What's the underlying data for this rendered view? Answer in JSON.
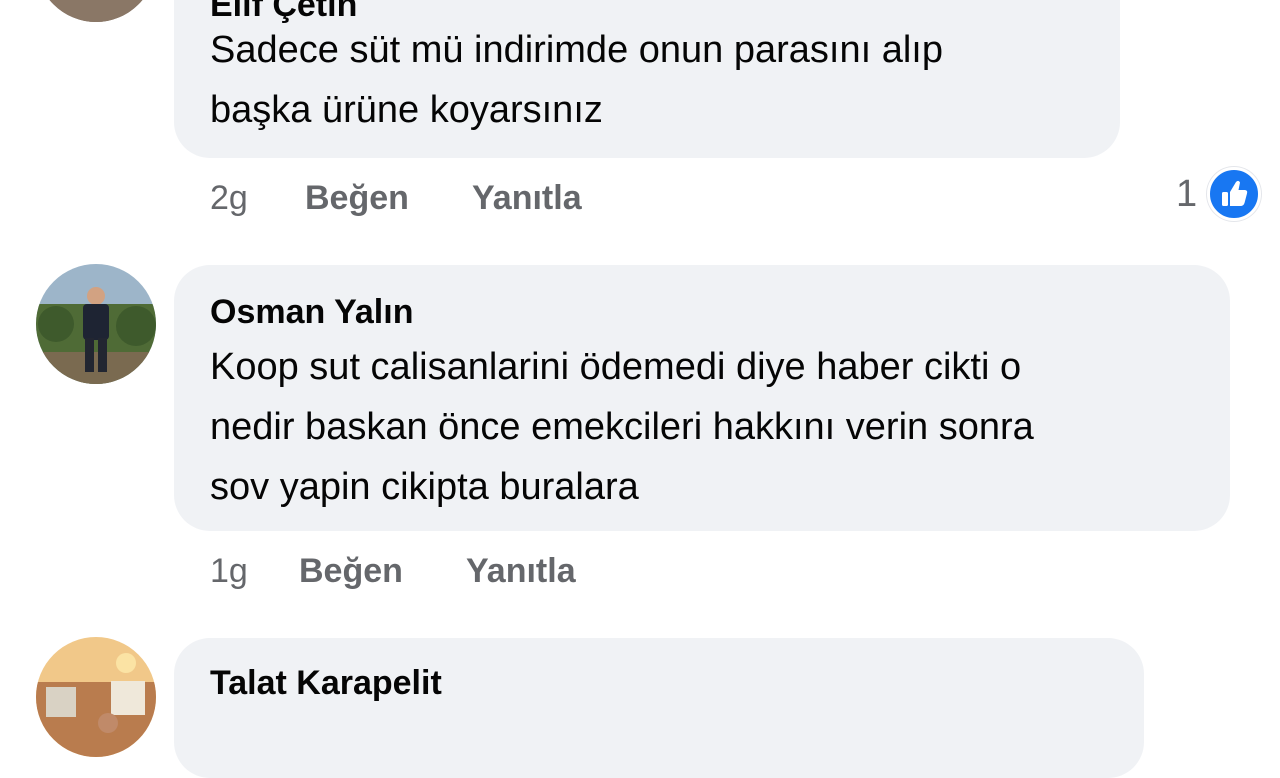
{
  "colors": {
    "bubble_bg": "#f0f2f5",
    "meta_text": "#65676b",
    "like_blue": "#1877f2"
  },
  "comments": [
    {
      "author": "Elif Çetin",
      "text": "Sadece süt mü indirimde onun parasını alıp\nbaşka ürüne koyarsınız",
      "time": "2g",
      "like_label": "Beğen",
      "reply_label": "Yanıtla",
      "reaction_count": "1",
      "reaction_icon": "thumbs-up-icon"
    },
    {
      "author": "Osman Yalın",
      "text": "Koop sut calisanlarini ödemedi diye haber cikti o\nnedir baskan önce emekcileri hakkını verin sonra\nsov yapin cikipta buralara",
      "time": "1g",
      "like_label": "Beğen",
      "reply_label": "Yanıtla"
    },
    {
      "author": "Talat Karapelit"
    }
  ]
}
